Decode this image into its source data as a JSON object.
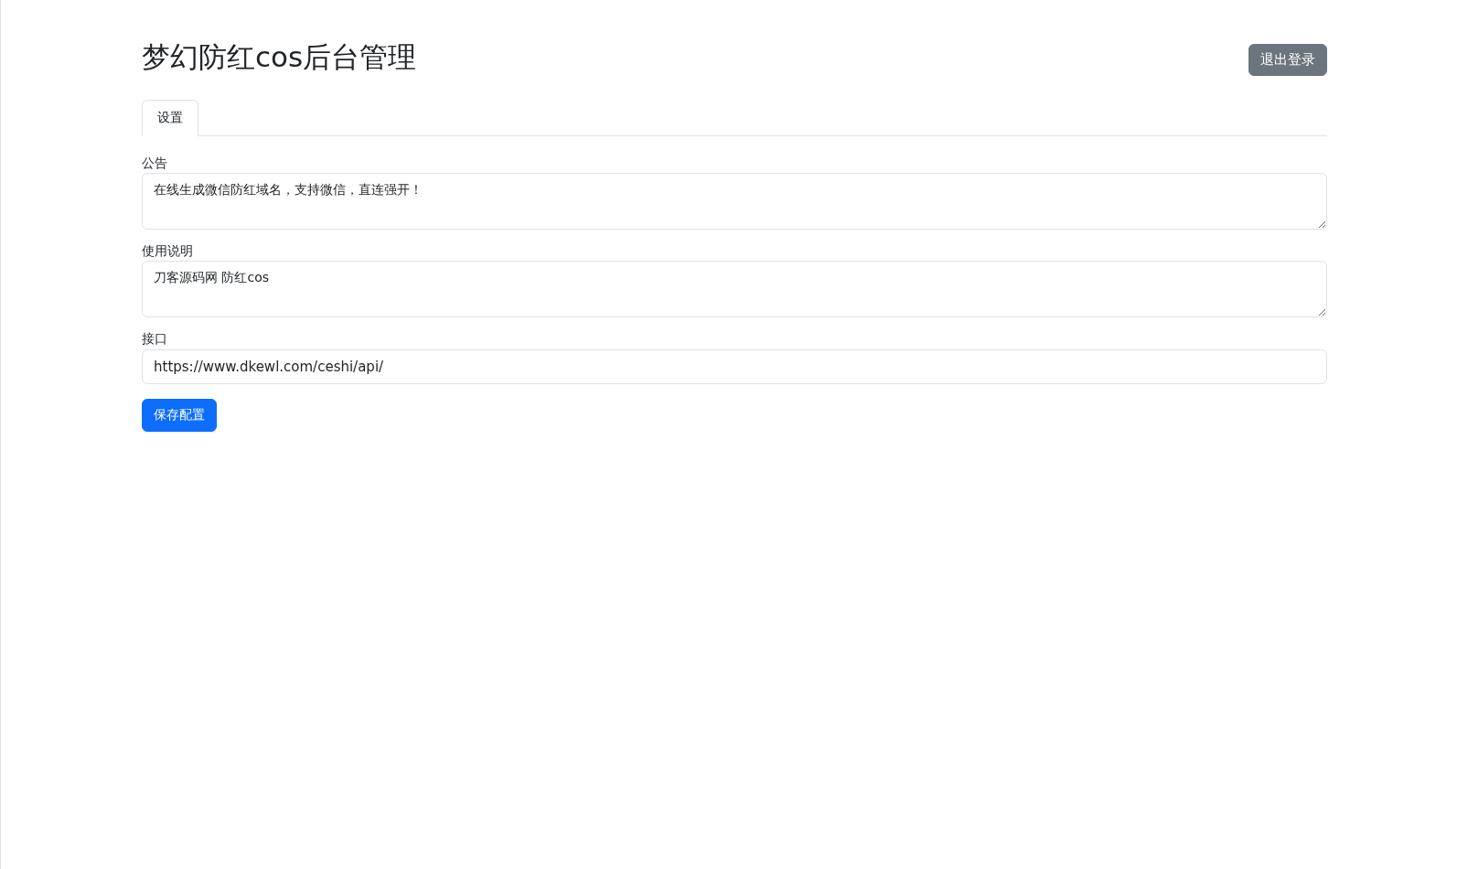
{
  "header": {
    "title": "梦幻防红cos后台管理",
    "logout_button": "退出登录"
  },
  "tabs": [
    {
      "label": "设置",
      "selected": true
    }
  ],
  "form": {
    "fields": [
      {
        "kind": "textarea",
        "label": "公告",
        "value": "在线生成微信防红域名，支持微信，直连强开！"
      },
      {
        "kind": "textarea",
        "label": "使用说明",
        "value": "刀客源码网 防红cos"
      },
      {
        "kind": "input",
        "label": "接口",
        "value": "https://www.dkewl.com/ceshi/api/"
      }
    ],
    "save_button": "保存配置"
  }
}
